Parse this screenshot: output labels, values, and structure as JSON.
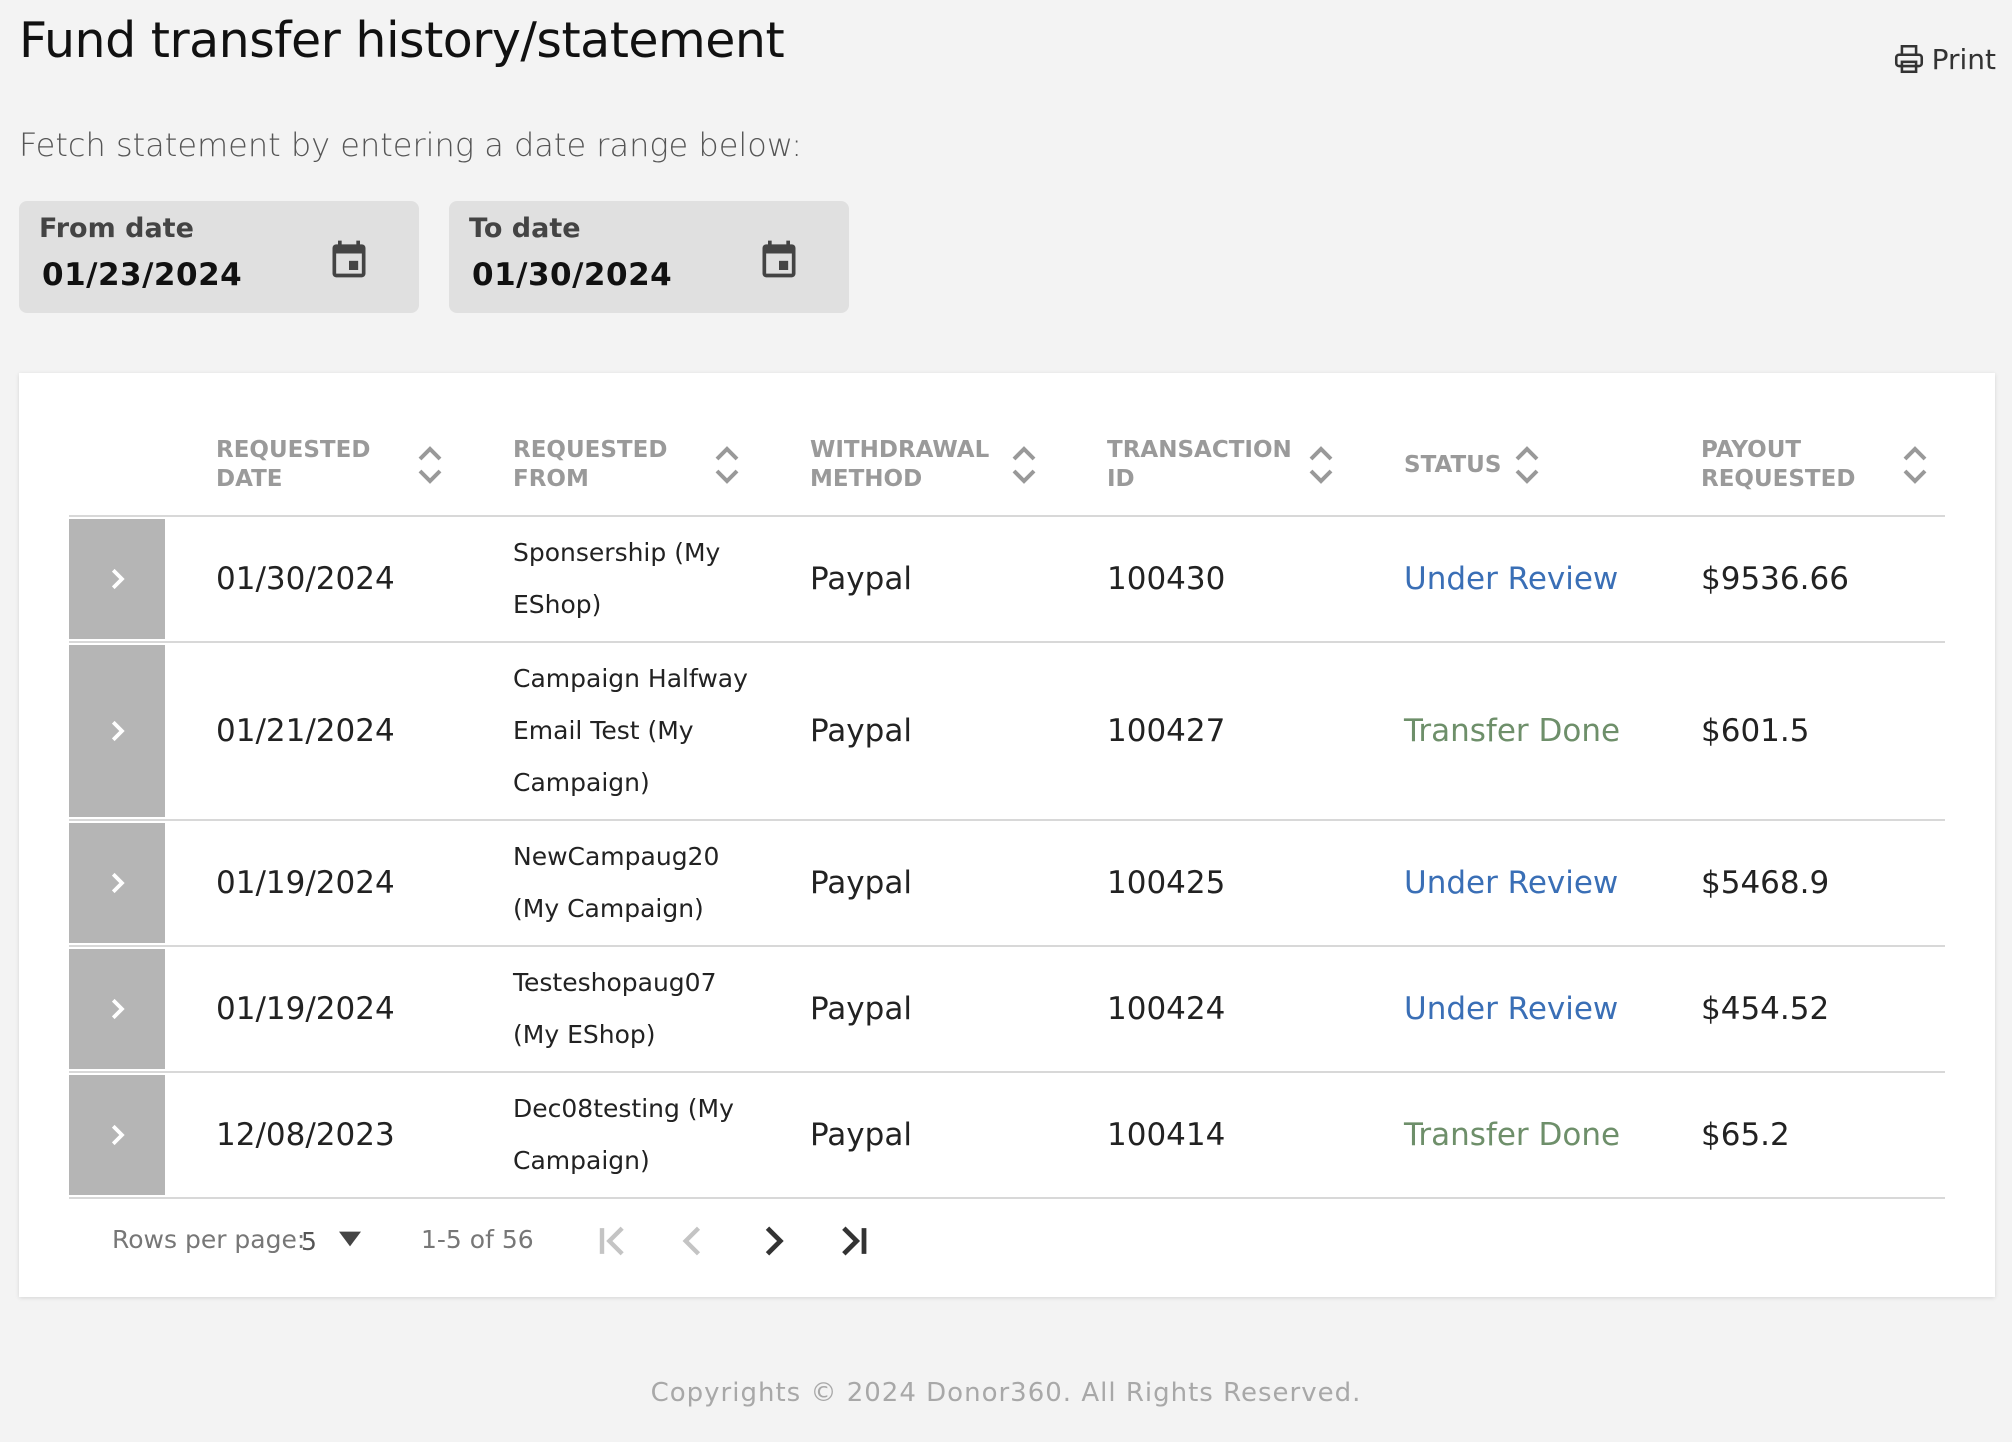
{
  "header": {
    "title": "Fund transfer history/statement",
    "print_label": "Print",
    "subtitle": "Fetch statement by entering a date range below:"
  },
  "filters": {
    "from_label": "From date",
    "from_value": "01/23/2024",
    "to_label": "To date",
    "to_value": "01/30/2024"
  },
  "table": {
    "columns": [
      "REQUESTED DATE",
      "REQUESTED FROM",
      "WITHDRAWAL METHOD",
      "TRANSACTION ID",
      "STATUS",
      "PAYOUT REQUESTED"
    ],
    "rows": [
      {
        "date": "01/30/2024",
        "from": "Sponsership (My EShop)",
        "method": "Paypal",
        "txn": "100430",
        "status": "Under Review",
        "payout": "$9536.66"
      },
      {
        "date": "01/21/2024",
        "from": "Campaign Halfway Email Test (My Campaign)",
        "method": "Paypal",
        "txn": "100427",
        "status": "Transfer Done",
        "payout": "$601.5"
      },
      {
        "date": "01/19/2024",
        "from": "NewCampaug20 (My Campaign)",
        "method": "Paypal",
        "txn": "100425",
        "status": "Under Review",
        "payout": "$5468.9"
      },
      {
        "date": "01/19/2024",
        "from": "Testeshopaug07 (My EShop)",
        "method": "Paypal",
        "txn": "100424",
        "status": "Under Review",
        "payout": "$454.52"
      },
      {
        "date": "12/08/2023",
        "from": "Dec08testing (My Campaign)",
        "method": "Paypal",
        "txn": "100414",
        "status": "Transfer Done",
        "payout": "$65.2"
      }
    ]
  },
  "pagination": {
    "rows_per_page_label": "Rows per page:",
    "rows_per_page_value": "5",
    "range_text": "1-5 of 56"
  },
  "footer": {
    "text": "Copyrights © 2024 Donor360. All Rights Reserved."
  },
  "colors": {
    "under_review": "#3a6fb6",
    "transfer_done": "#6e8f6a",
    "expand_cell": "#b5b5b5"
  },
  "icons": [
    "printer-icon",
    "calendar-icon",
    "sort-icon",
    "chevron-right-icon",
    "caret-down-icon",
    "first-page-icon",
    "prev-page-icon",
    "next-page-icon",
    "last-page-icon"
  ]
}
